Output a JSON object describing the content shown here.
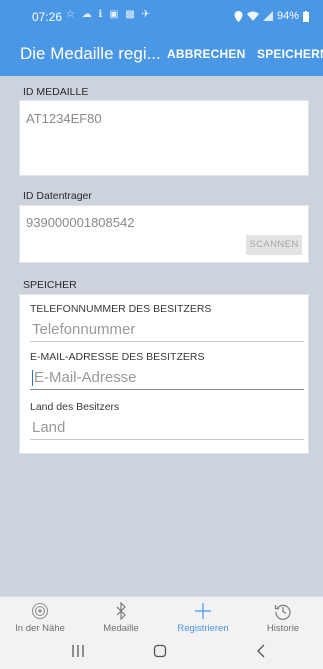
{
  "status_bar": {
    "time": "07:26",
    "notifications": "☆ ☁ ℹ ▣ ▩ ✈",
    "battery": "94%"
  },
  "app_bar": {
    "title": "Die Medaille regi...",
    "cancel": "ABBRECHEN",
    "save": "SPEICHERN"
  },
  "medal": {
    "label": "ID MEDAILLE",
    "value": "AT1234EF80"
  },
  "transponder": {
    "label": "ID Datentrager",
    "value": "939000001808542",
    "scan": "SCANNEN"
  },
  "storage": {
    "label": "SPEICHER",
    "phone": {
      "label": "TELEFONNUMMER DES BESITZERS",
      "placeholder": "Telefonnummer"
    },
    "email": {
      "label": "E-MAIL-ADRESSE DES BESITZERS",
      "placeholder": "E-Mail-Adresse"
    },
    "country": {
      "label": "Land des Besitzers",
      "placeholder": "Land"
    }
  },
  "bottom_nav": [
    {
      "label": "In der Nähe",
      "icon": "location-target-icon"
    },
    {
      "label": "Medaille",
      "icon": "bluetooth-icon"
    },
    {
      "label": "Registrieren",
      "icon": "plus-icon"
    },
    {
      "label": "Historie",
      "icon": "history-icon"
    }
  ],
  "colors": {
    "primary": "#4a97e6",
    "background": "#cdd3dc"
  }
}
